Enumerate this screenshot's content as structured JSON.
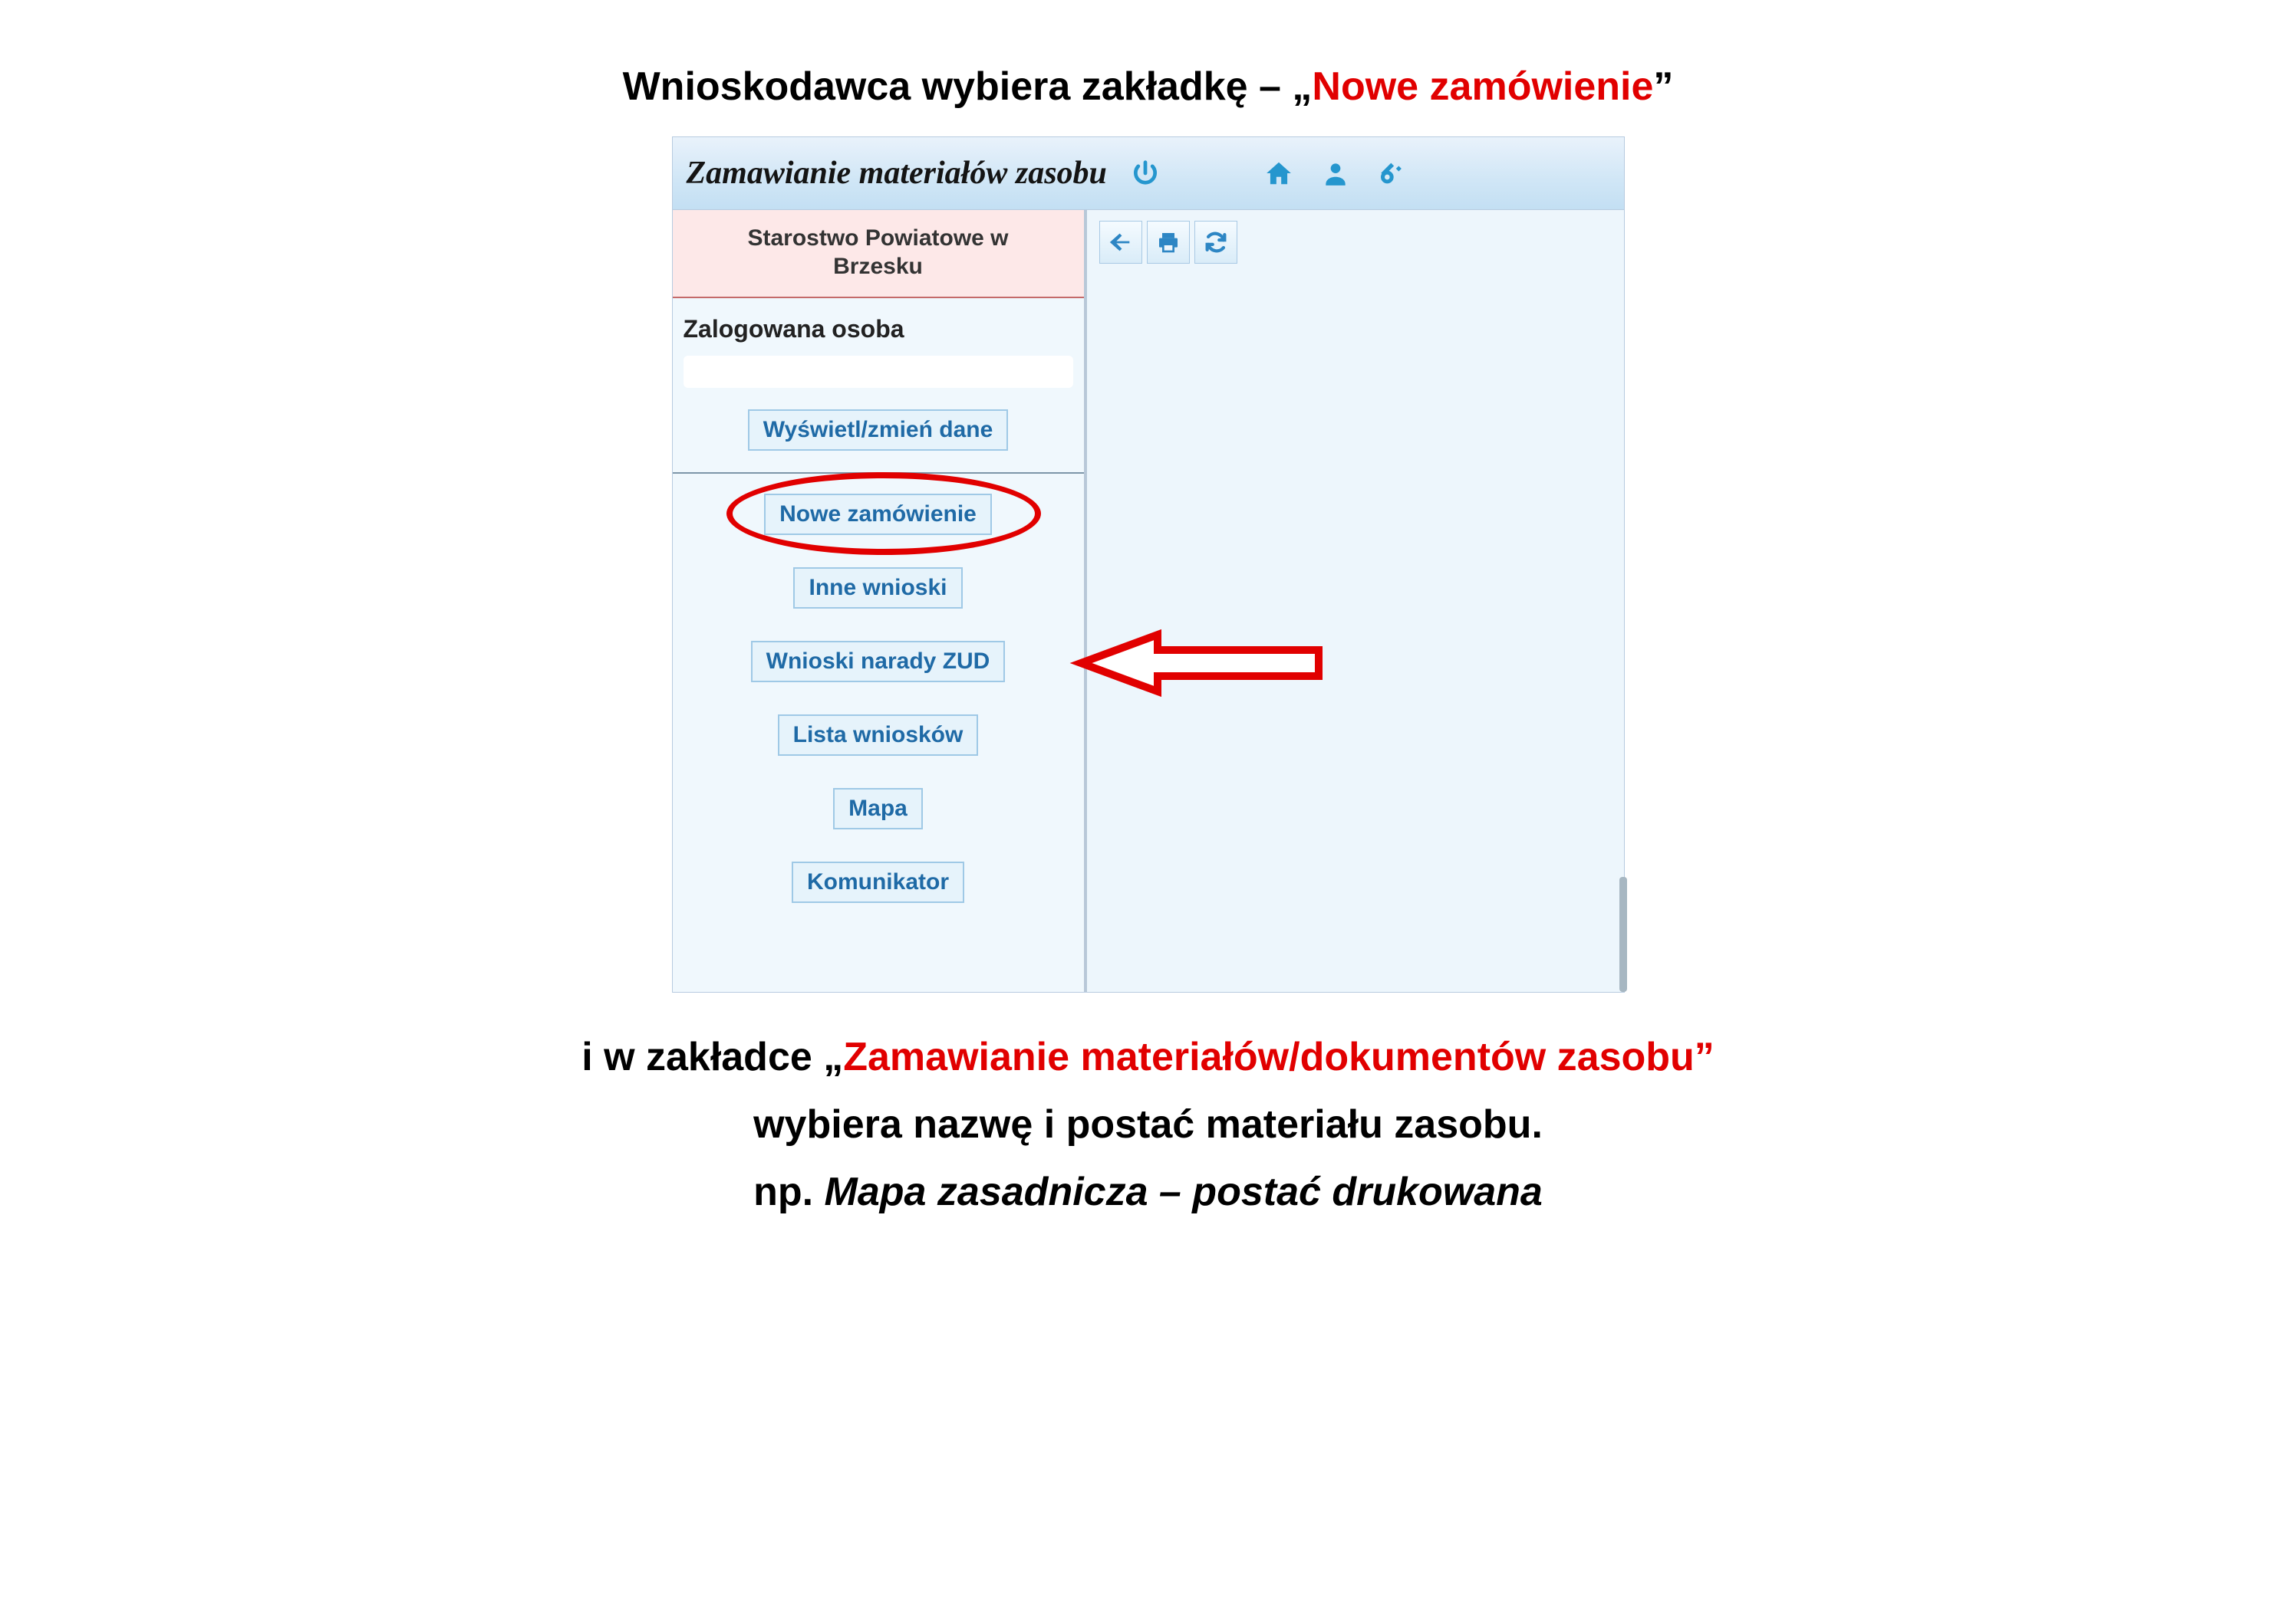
{
  "heading": {
    "before": "Wnioskodawca wybiera zakładkę – „",
    "highlight": "Nowe zamówienie",
    "after": "”"
  },
  "below": {
    "line1_before": "i w zakładce „",
    "line1_red": "Zamawianie materiałów/dokumentów zasobu”",
    "line2": "wybiera nazwę i postać materiału zasobu.",
    "line3_prefix": "np. ",
    "line3_italic": "Mapa zasadnicza – postać drukowana"
  },
  "header": {
    "title": "Zamawianie materiałów zasobu"
  },
  "colors": {
    "accent_blue": "#2596ce",
    "annotation_red": "#e10000",
    "link_blue": "#1f6aa6"
  },
  "sidebar": {
    "org_line1": "Starostwo Powiatowe w",
    "org_line2": "Brzesku",
    "logged_label": "Zalogowana osoba",
    "view_change": "Wyświetl/zmień dane",
    "nav": [
      "Nowe zamówienie",
      "Inne wnioski",
      "Wnioski narady ZUD",
      "Lista wniosków",
      "Mapa",
      "Komunikator"
    ]
  },
  "icons": {
    "power": "power-icon",
    "home": "home-icon",
    "user": "user-icon",
    "key": "key-icon",
    "back": "back-arrow-icon",
    "print": "print-icon",
    "refresh": "refresh-icon"
  }
}
